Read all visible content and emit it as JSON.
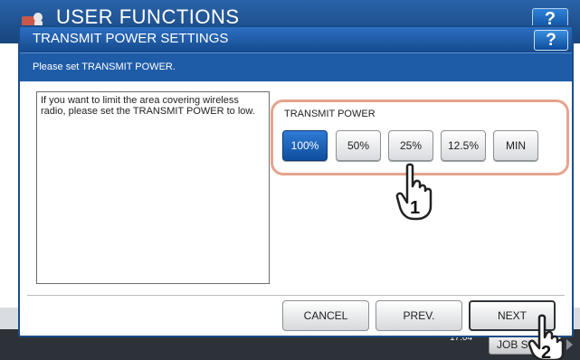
{
  "background": {
    "title": "USER FUNCTIONS",
    "help_label": "?",
    "clock_date": "",
    "clock_time": "17:04",
    "job_button": "JOB S"
  },
  "dialog": {
    "title": "TRANSMIT POWER SETTINGS",
    "help_label": "?",
    "message": "Please set TRANSMIT POWER.",
    "description": "If you want to limit the area covering wireless radio, please set the TRANSMIT POWER to low.",
    "transmit_power": {
      "label": "TRANSMIT POWER",
      "options": [
        "100%",
        "50%",
        "25%",
        "12.5%",
        "MIN"
      ],
      "selected": "100%"
    },
    "buttons": {
      "cancel": "CANCEL",
      "prev": "PREV.",
      "next": "NEXT"
    }
  },
  "callouts": {
    "step1": "1",
    "step2": "2"
  },
  "colors": {
    "title_bar": "#1f5ca8",
    "selected_option": "#1a5fb4",
    "highlight_frame": "#e6a48c"
  }
}
